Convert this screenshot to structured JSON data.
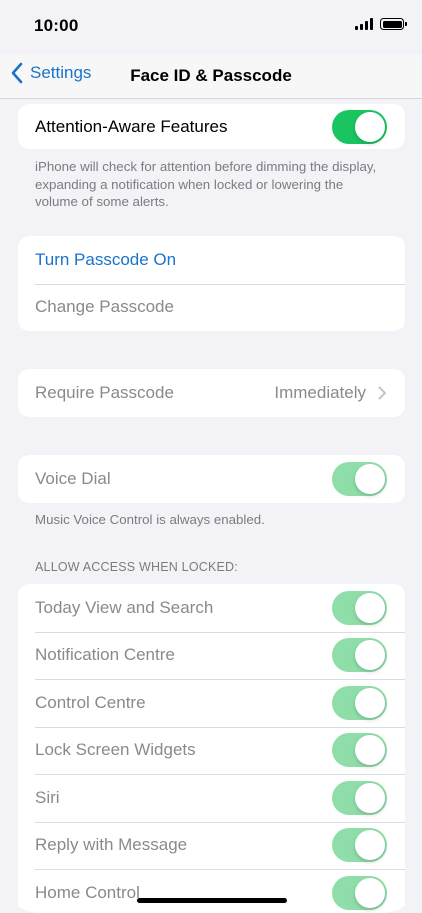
{
  "status_bar": {
    "time": "10:00"
  },
  "nav": {
    "back_label": "Settings",
    "title": "Face ID & Passcode"
  },
  "attention": {
    "label": "Attention-Aware Features",
    "on": true,
    "footnote": "iPhone will check for attention before dimming the display, expanding a notification when locked or lowering the volume of some alerts."
  },
  "passcode": {
    "turn_on_label": "Turn Passcode On",
    "change_label": "Change Passcode"
  },
  "require": {
    "label": "Require Passcode",
    "value": "Immediately"
  },
  "voice_dial": {
    "label": "Voice Dial",
    "on": true,
    "footnote": "Music Voice Control is always enabled."
  },
  "locked_access": {
    "header": "ALLOW ACCESS WHEN LOCKED:",
    "items": [
      {
        "label": "Today View and Search",
        "on": true
      },
      {
        "label": "Notification Centre",
        "on": true
      },
      {
        "label": "Control Centre",
        "on": true
      },
      {
        "label": "Lock Screen Widgets",
        "on": true
      },
      {
        "label": "Siri",
        "on": true
      },
      {
        "label": "Reply with Message",
        "on": true
      },
      {
        "label": "Home Control",
        "on": true
      }
    ]
  },
  "colors": {
    "accent": "#1a73c9",
    "toggle_on": "#1ac461",
    "toggle_disabled": "#8fdeaa"
  }
}
